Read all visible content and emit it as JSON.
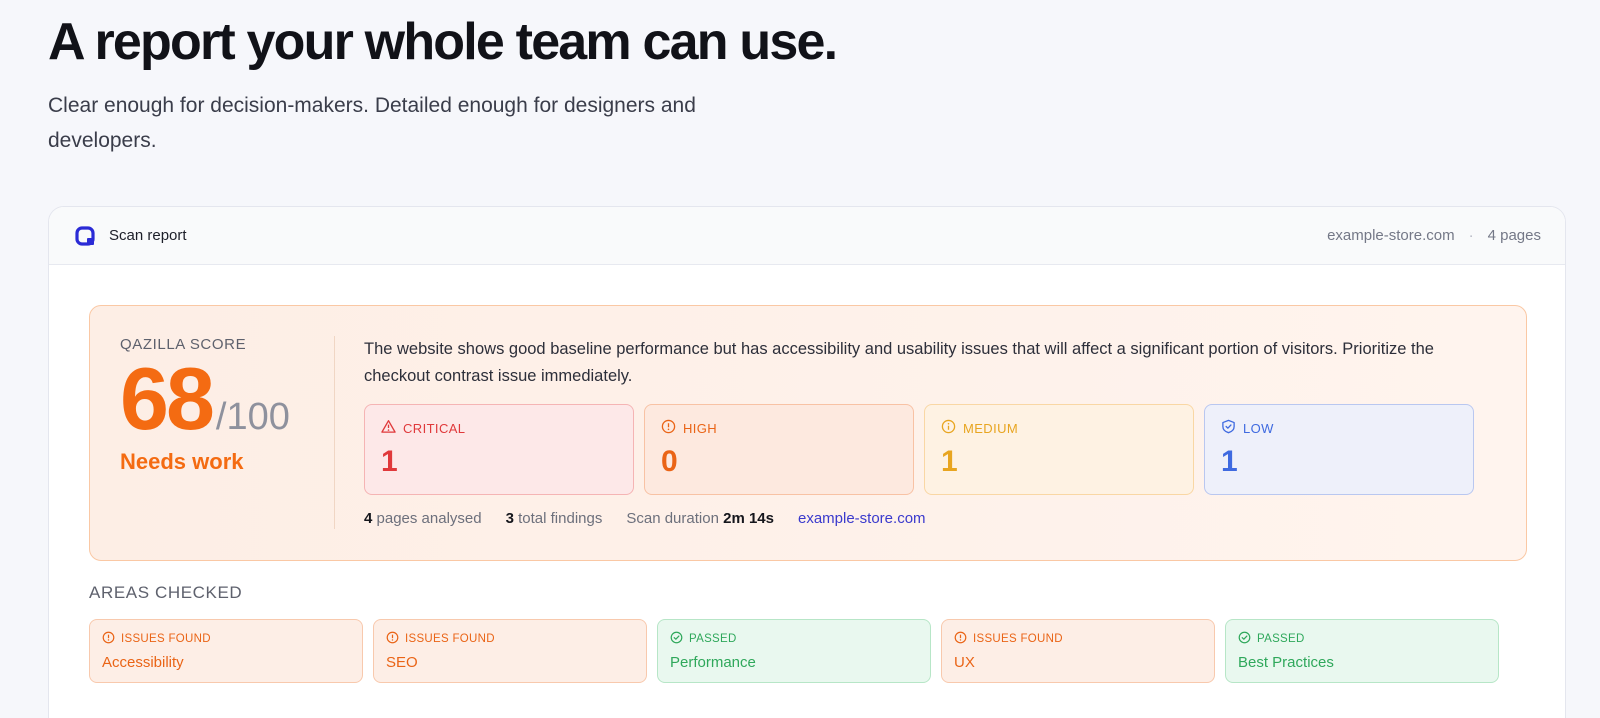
{
  "hero": {
    "title": "A report your whole team can use.",
    "subtitle": "Clear enough for decision-makers. Detailed enough for designers and developers."
  },
  "report": {
    "header": {
      "logo_icon": "qazilla-logo-icon",
      "title": "Scan report",
      "domain": "example-store.com",
      "separator": "·",
      "pages": "4 pages"
    },
    "score": {
      "label": "QAZILLA SCORE",
      "value": "68",
      "max": "/100",
      "status": "Needs work",
      "accent_color": "#f46b12"
    },
    "summary": "The website shows good baseline performance but has accessibility and usability issues that will affect a significant portion of visitors. Prioritize the checkout contrast issue immediately.",
    "severities": [
      {
        "label": "CRITICAL",
        "count": "1",
        "icon": "warning-triangle-icon",
        "color": "#e0393b"
      },
      {
        "label": "HIGH",
        "count": "0",
        "icon": "alert-circle-icon",
        "color": "#ea6416"
      },
      {
        "label": "MEDIUM",
        "count": "1",
        "icon": "info-circle-icon",
        "color": "#e8a520"
      },
      {
        "label": "LOW",
        "count": "1",
        "icon": "shield-check-icon",
        "color": "#3f6ae0"
      }
    ],
    "stats": {
      "pages_count": "4",
      "pages_label": "pages analysed",
      "findings_count": "3",
      "findings_label": "total findings",
      "duration_label": "Scan duration",
      "duration_value": "2m 14s",
      "link": "example-store.com"
    },
    "areas": {
      "title": "AREAS CHECKED",
      "items": [
        {
          "status": "ISSUES FOUND",
          "name": "Accessibility",
          "icon": "alert-circle-icon"
        },
        {
          "status": "ISSUES FOUND",
          "name": "SEO",
          "icon": "alert-circle-icon"
        },
        {
          "status": "PASSED",
          "name": "Performance",
          "icon": "check-circle-icon"
        },
        {
          "status": "ISSUES FOUND",
          "name": "UX",
          "icon": "alert-circle-icon"
        },
        {
          "status": "PASSED",
          "name": "Best Practices",
          "icon": "check-circle-icon"
        }
      ]
    }
  }
}
